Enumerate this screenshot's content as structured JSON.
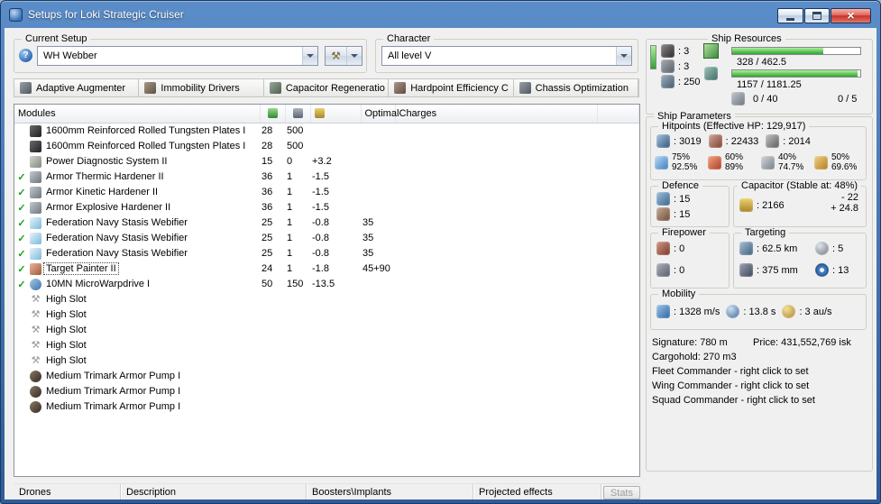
{
  "window": {
    "title": "Setups for Loki Strategic Cruiser"
  },
  "icons": {
    "app": "app-icon",
    "minimize": "minimize-icon",
    "maximize": "maximize-icon",
    "close": "close-icon",
    "help": "help-icon",
    "wrench": "wrench-icon",
    "dropdown_arrow": "dropdown-arrow-icon",
    "cpu": "cpu-chip-icon",
    "powergrid": "powergrid-icon",
    "drone": "drone-bay-icon",
    "columns": [
      "cpu-column-icon",
      "powergrid-column-icon",
      "capacitor-column-icon"
    ]
  },
  "setup": {
    "label": "Current Setup",
    "value": "WH Webber"
  },
  "character": {
    "label": "Character",
    "value": "All level V"
  },
  "subsystems": [
    {
      "icon": "defensive-subsystem-icon",
      "label": "Adaptive Augmenter"
    },
    {
      "icon": "propulsion-subsystem-icon",
      "label": "Immobility Drivers"
    },
    {
      "icon": "engineering-subsystem-icon",
      "label": "Capacitor Regeneratio"
    },
    {
      "icon": "offensive-subsystem-icon",
      "label": "Hardpoint Efficiency C"
    },
    {
      "icon": "core-subsystem-icon",
      "label": "Chassis Optimization"
    }
  ],
  "modules": {
    "header": {
      "name": "Modules",
      "optimal": "Optimal",
      "charges": "Charges"
    },
    "rows": [
      {
        "active": false,
        "selected": false,
        "icon": "armor-plate-icon",
        "name": "1600mm Reinforced Rolled Tungsten Plates I",
        "cpu": "28",
        "pg": "500",
        "cap": "",
        "optimal": "",
        "charges": ""
      },
      {
        "active": false,
        "selected": false,
        "icon": "armor-plate-icon",
        "name": "1600mm Reinforced Rolled Tungsten Plates I",
        "cpu": "28",
        "pg": "500",
        "cap": "",
        "optimal": "",
        "charges": ""
      },
      {
        "active": false,
        "selected": false,
        "icon": "power-diagnostic-icon",
        "name": "Power Diagnostic System II",
        "cpu": "15",
        "pg": "0",
        "cap": "+3.2",
        "optimal": "",
        "charges": ""
      },
      {
        "active": true,
        "selected": false,
        "icon": "armor-hardener-icon",
        "name": "Armor Thermic Hardener II",
        "cpu": "36",
        "pg": "1",
        "cap": "-1.5",
        "optimal": "",
        "charges": ""
      },
      {
        "active": true,
        "selected": false,
        "icon": "armor-hardener-icon",
        "name": "Armor Kinetic Hardener II",
        "cpu": "36",
        "pg": "1",
        "cap": "-1.5",
        "optimal": "",
        "charges": ""
      },
      {
        "active": true,
        "selected": false,
        "icon": "armor-hardener-icon",
        "name": "Armor Explosive Hardener II",
        "cpu": "36",
        "pg": "1",
        "cap": "-1.5",
        "optimal": "",
        "charges": ""
      },
      {
        "active": true,
        "selected": false,
        "icon": "webifier-icon",
        "name": "Federation Navy Stasis Webifier",
        "cpu": "25",
        "pg": "1",
        "cap": "-0.8",
        "optimal": "35",
        "charges": ""
      },
      {
        "active": true,
        "selected": false,
        "icon": "webifier-icon",
        "name": "Federation Navy Stasis Webifier",
        "cpu": "25",
        "pg": "1",
        "cap": "-0.8",
        "optimal": "35",
        "charges": ""
      },
      {
        "active": true,
        "selected": false,
        "icon": "webifier-icon",
        "name": "Federation Navy Stasis Webifier",
        "cpu": "25",
        "pg": "1",
        "cap": "-0.8",
        "optimal": "35",
        "charges": ""
      },
      {
        "active": true,
        "selected": true,
        "icon": "target-painter-icon",
        "name": "Target Painter II",
        "cpu": "24",
        "pg": "1",
        "cap": "-1.8",
        "optimal": "45+90",
        "charges": ""
      },
      {
        "active": true,
        "selected": false,
        "icon": "mwd-icon",
        "name": "10MN MicroWarpdrive I",
        "cpu": "50",
        "pg": "150",
        "cap": "-13.5",
        "optimal": "",
        "charges": ""
      },
      {
        "active": false,
        "selected": false,
        "icon": "empty-slot-icon",
        "name": "High Slot",
        "cpu": "",
        "pg": "",
        "cap": "",
        "optimal": "",
        "charges": ""
      },
      {
        "active": false,
        "selected": false,
        "icon": "empty-slot-icon",
        "name": "High Slot",
        "cpu": "",
        "pg": "",
        "cap": "",
        "optimal": "",
        "charges": ""
      },
      {
        "active": false,
        "selected": false,
        "icon": "empty-slot-icon",
        "name": "High Slot",
        "cpu": "",
        "pg": "",
        "cap": "",
        "optimal": "",
        "charges": ""
      },
      {
        "active": false,
        "selected": false,
        "icon": "empty-slot-icon",
        "name": "High Slot",
        "cpu": "",
        "pg": "",
        "cap": "",
        "optimal": "",
        "charges": ""
      },
      {
        "active": false,
        "selected": false,
        "icon": "empty-slot-icon",
        "name": "High Slot",
        "cpu": "",
        "pg": "",
        "cap": "",
        "optimal": "",
        "charges": ""
      },
      {
        "active": false,
        "selected": false,
        "icon": "rig-icon",
        "name": "Medium Trimark Armor Pump I",
        "cpu": "",
        "pg": "",
        "cap": "",
        "optimal": "",
        "charges": ""
      },
      {
        "active": false,
        "selected": false,
        "icon": "rig-icon",
        "name": "Medium Trimark Armor Pump I",
        "cpu": "",
        "pg": "",
        "cap": "",
        "optimal": "",
        "charges": ""
      },
      {
        "active": false,
        "selected": false,
        "icon": "rig-icon",
        "name": "Medium Trimark Armor Pump I",
        "cpu": "",
        "pg": "",
        "cap": "",
        "optimal": "",
        "charges": ""
      }
    ]
  },
  "resources": {
    "label": "Ship Resources",
    "vbar_pct": 100,
    "slots": [
      {
        "icon": "turret-hardpoint-icon",
        "value": ": 3"
      },
      {
        "icon": "launcher-hardpoint-icon",
        "value": ": 3"
      },
      {
        "icon": "calibration-icon",
        "value": ": 250"
      }
    ],
    "cpu": {
      "text": "328 / 462.5",
      "pct": 71
    },
    "powergrid": {
      "text": "1157 / 1181.25",
      "pct": 98
    },
    "dronebay": "0 / 40",
    "bandwidth": "0 / 5"
  },
  "parameters": {
    "label": "Ship Parameters",
    "hitpoints": {
      "label": "Hitpoints (Effective HP: 129,917)",
      "pools": [
        {
          "icon": "shield-icon",
          "value": ": 3019"
        },
        {
          "icon": "armor-icon",
          "value": ": 22433"
        },
        {
          "icon": "structure-icon",
          "value": ": 2014"
        }
      ],
      "resists": [
        {
          "icon": "em-resist-icon",
          "shield": "75%",
          "armor": "92.5%"
        },
        {
          "icon": "thermal-resist-icon",
          "shield": "60%",
          "armor": "89%"
        },
        {
          "icon": "kinetic-resist-icon",
          "shield": "40%",
          "armor": "74.7%"
        },
        {
          "icon": "explosive-resist-icon",
          "shield": "50%",
          "armor": "69.6%"
        }
      ]
    },
    "defence": {
      "label": "Defence",
      "items": [
        {
          "icon": "shield-recharge-icon",
          "value": ": 15"
        },
        {
          "icon": "armor-repair-icon",
          "value": ": 15"
        }
      ]
    },
    "capacitor": {
      "label": "Capacitor (Stable at: 48%)",
      "amount": ": 2166",
      "drain": "- 22",
      "recharge": "+ 24.8"
    },
    "firepower": {
      "label": "Firepower",
      "items": [
        {
          "icon": "volley-icon",
          "value": ": 0"
        },
        {
          "icon": "dps-icon",
          "value": ": 0"
        }
      ]
    },
    "targeting": {
      "label": "Targeting",
      "items": [
        {
          "icon": "targeting-range-icon",
          "value": ": 62.5 km"
        },
        {
          "icon": "max-targets-icon",
          "value": ": 5"
        },
        {
          "icon": "scan-resolution-icon",
          "value": ": 375 mm"
        },
        {
          "icon": "sensor-strength-icon",
          "value": ": 13"
        }
      ]
    },
    "mobility": {
      "label": "Mobility",
      "items": [
        {
          "icon": "speed-icon",
          "value": ": 1328 m/s"
        },
        {
          "icon": "align-time-icon",
          "value": ": 13.8 s"
        },
        {
          "icon": "warp-speed-icon",
          "value": ": 3 au/s"
        }
      ]
    },
    "info": {
      "signature": "Signature: 780 m",
      "price": "Price: 431,552,769 isk",
      "cargohold": "Cargohold: 270 m3",
      "fleet": "Fleet Commander - right click to set",
      "wing": "Wing Commander - right click to set",
      "squad": "Squad Commander - right click to set"
    }
  },
  "bottom": {
    "tabs": [
      "Drones",
      "Description",
      "Boosters\\Implants",
      "Projected effects"
    ],
    "stats_button": "Stats"
  }
}
